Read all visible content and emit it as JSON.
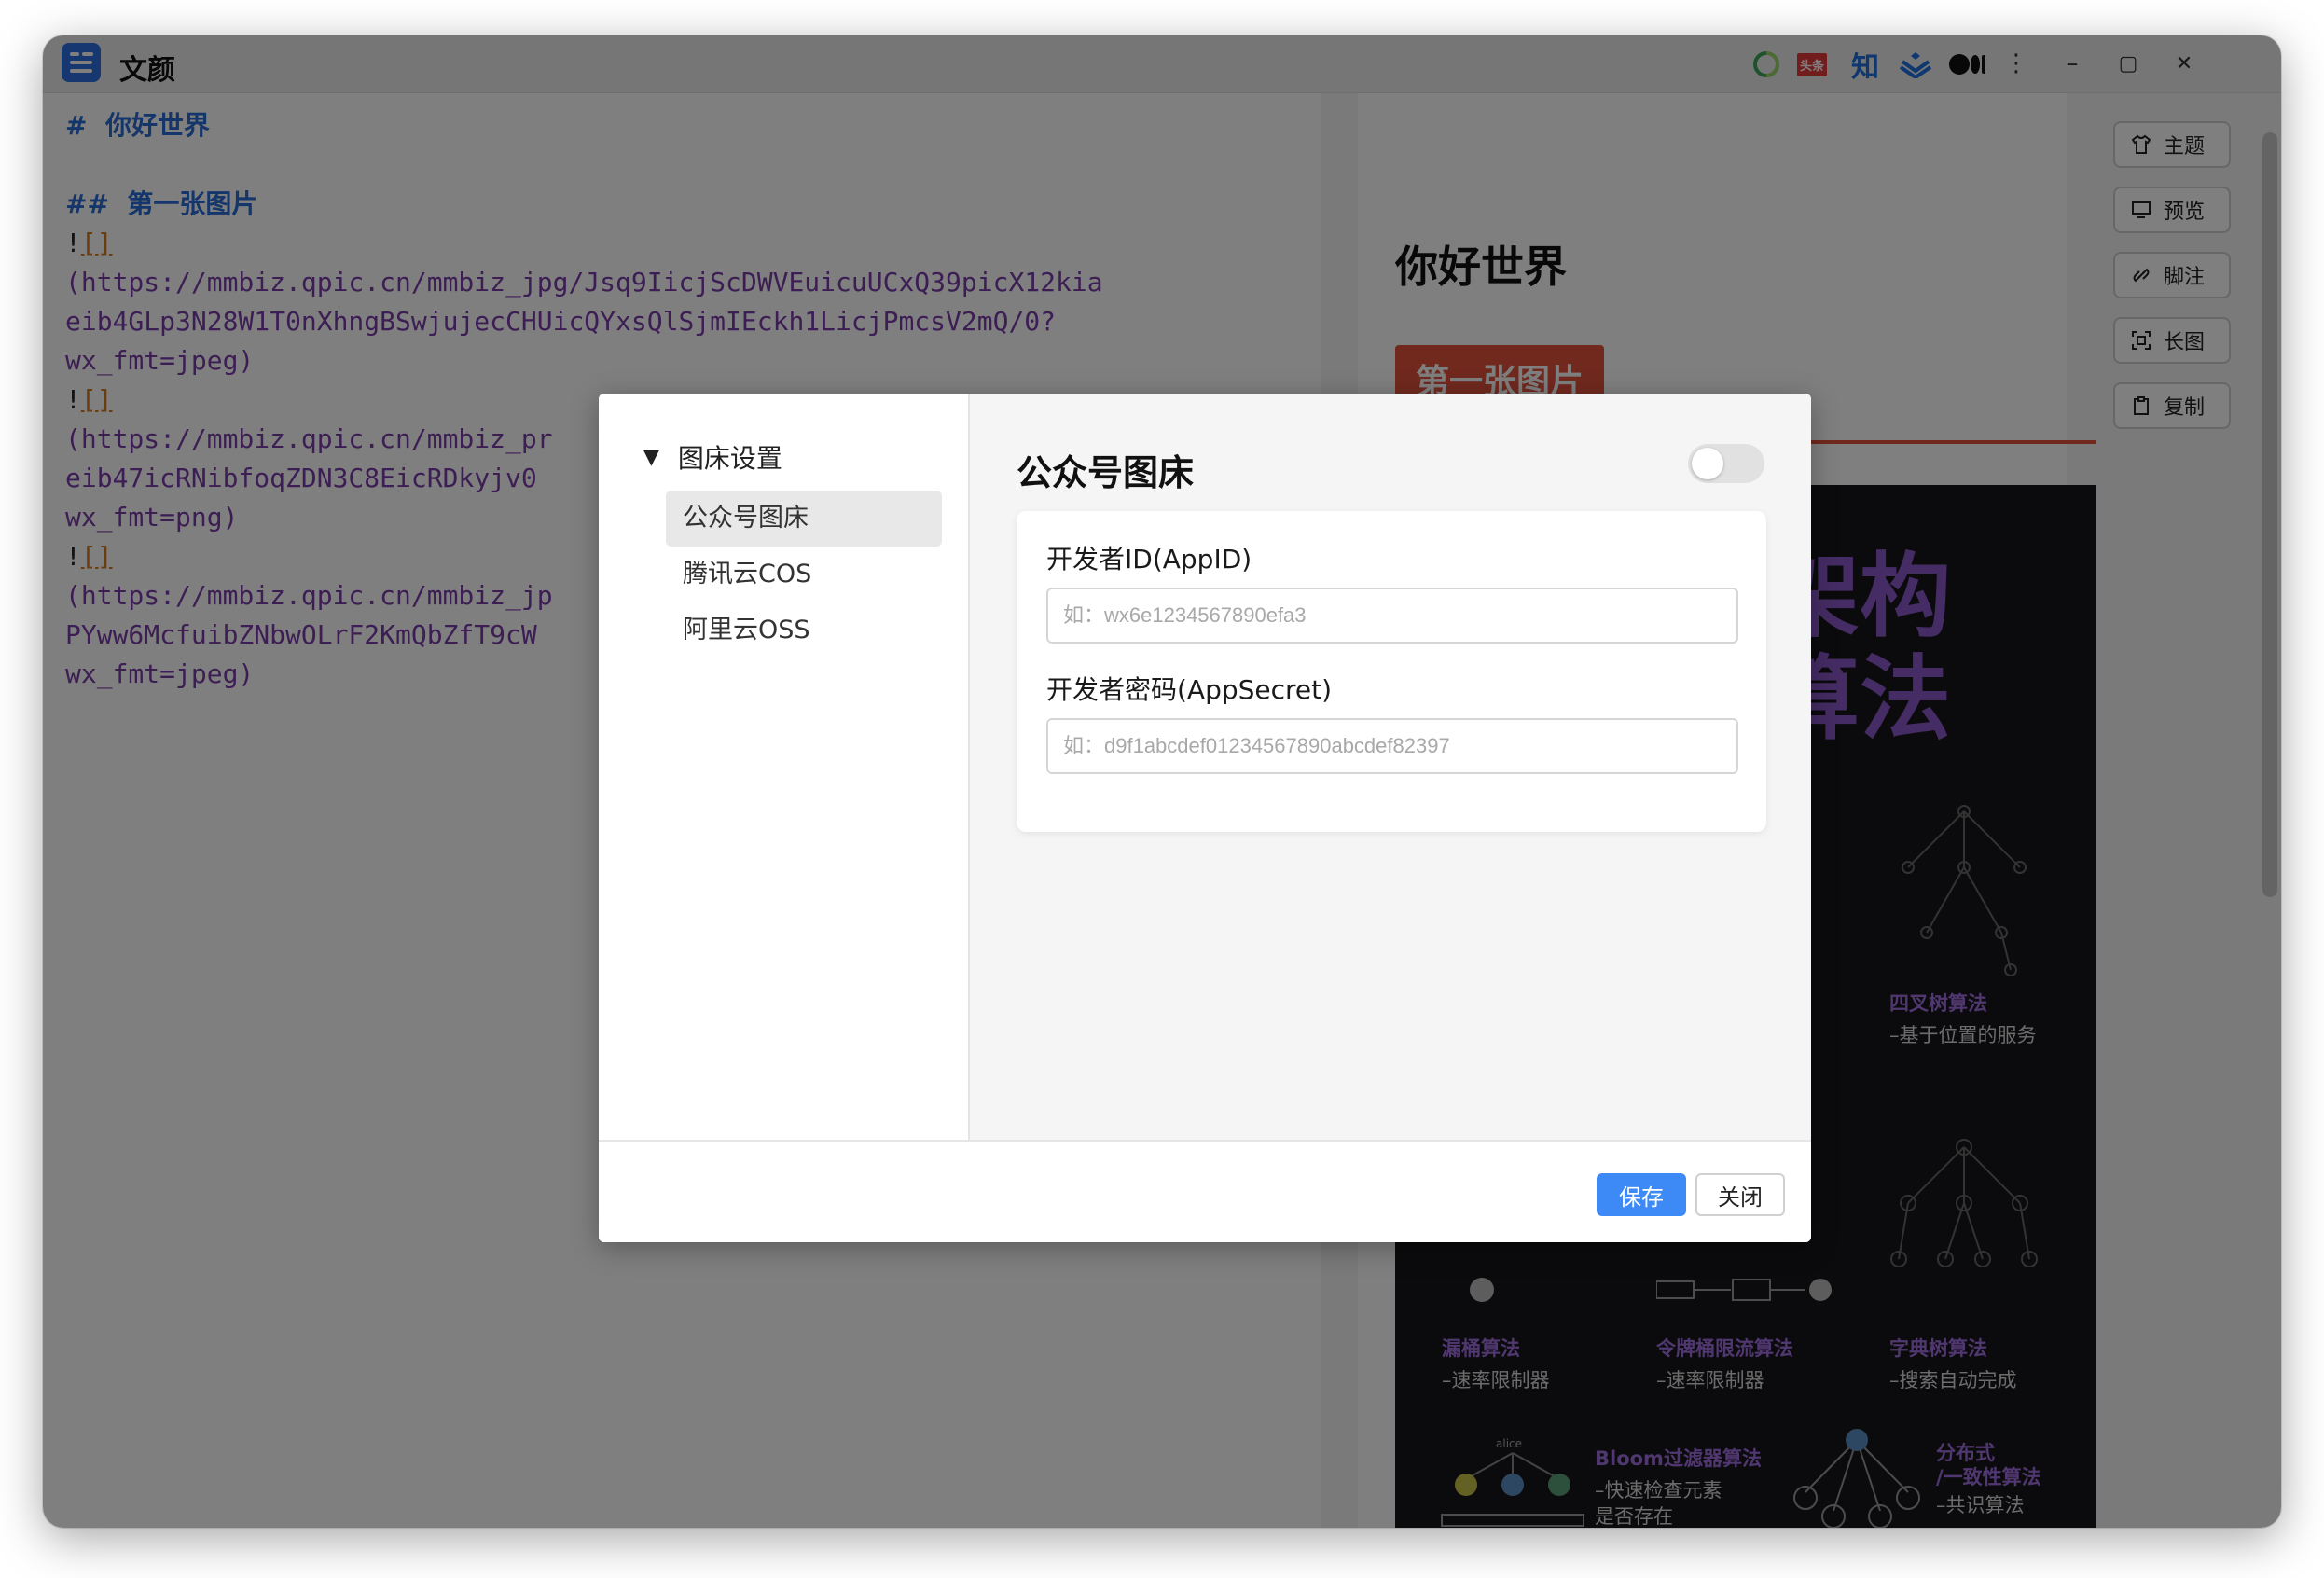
{
  "app": {
    "title": "文颜"
  },
  "titlebar": {
    "extensions": [
      {
        "name": "wechat-icon",
        "glyph": "◌",
        "color": "#3aa757"
      },
      {
        "name": "toutiao-icon",
        "glyph": "头条",
        "color": "#e23b3b"
      },
      {
        "name": "zhihu-icon",
        "glyph": "知",
        "color": "#1e6fe0"
      },
      {
        "name": "juejin-icon",
        "glyph": "≋",
        "color": "#1e6fe0"
      },
      {
        "name": "medium-icon",
        "glyph": "●●|",
        "color": "#111111"
      }
    ],
    "controls": {
      "more": "⋮",
      "minimize": "–",
      "maximize": "▢",
      "close": "✕"
    }
  },
  "editor": {
    "h1": "#  你好世界",
    "h2": "##  第一张图片",
    "img1_line1": "(https://mmbiz.qpic.cn/mmbiz_jpg/Jsq9IicjScDWVEuicuUCxQ39picX12kia",
    "img1_line2": "eib4GLp3N28W1T0nXhngBSwjujecCHUicQYxsQlSjmIEckh1LicjPmcsV2mQ/0?",
    "img1_line3": "wx_fmt=jpeg)",
    "img2_line1": "(https://mmbiz.qpic.cn/mmbiz_pr",
    "img2_line2": "eib47icRNibfoqZDN3C8EicRDkyjv0",
    "img2_line3": "wx_fmt=png)",
    "img3_line1": "(https://mmbiz.qpic.cn/mmbiz_jp",
    "img3_line2": "PYww6McfuibZNbwOLrF2KmQbZfT9cW",
    "img3_line3": "wx_fmt=jpeg)",
    "bang": "!",
    "bracket": "[]"
  },
  "preview": {
    "title": "你好世界",
    "h2": "第一张图片",
    "poster": {
      "big1": "架构",
      "big2": "算法",
      "labels": [
        {
          "title": "四叉树算法",
          "sub": "–基于位置的服务"
        },
        {
          "title": "漏桶算法",
          "sub": "–速率限制器"
        },
        {
          "title": "令牌桶限流算法",
          "sub": "–速率限制器"
        },
        {
          "title": "字典树算法",
          "sub": "–搜索自动完成"
        },
        {
          "title": "Bloom过滤器算法",
          "sub": "–快速检查元素",
          "sub2": "是否存在"
        },
        {
          "title": "分布式",
          "title2": "/一致性算法",
          "sub": "–共识算法"
        }
      ],
      "node_label": "alice"
    }
  },
  "sidebar_buttons": [
    {
      "label": "主题",
      "icon": "shirt-icon",
      "glyph": "👕"
    },
    {
      "label": "预览",
      "icon": "monitor-icon",
      "glyph": "🖵"
    },
    {
      "label": "脚注",
      "icon": "link-icon",
      "glyph": "🔗"
    },
    {
      "label": "长图",
      "icon": "screenshot-icon",
      "glyph": "⛶"
    },
    {
      "label": "复制",
      "icon": "clipboard-icon",
      "glyph": "📋"
    }
  ],
  "dialog": {
    "nav": {
      "header": "图床设置",
      "toggle_glyph": "▼",
      "items": [
        "公众号图床",
        "腾讯云COS",
        "阿里云OSS"
      ],
      "active_index": 0
    },
    "main": {
      "title": "公众号图床",
      "enabled": false,
      "fields": [
        {
          "label": "开发者ID(AppID)",
          "placeholder": "如：wx6e1234567890efa3",
          "value": ""
        },
        {
          "label": "开发者密码(AppSecret)",
          "placeholder": "如：d9f1abcdef01234567890abcdef82397",
          "value": ""
        }
      ]
    },
    "footer": {
      "save": "保存",
      "close": "关闭"
    },
    "accent": "#3d8af7"
  }
}
